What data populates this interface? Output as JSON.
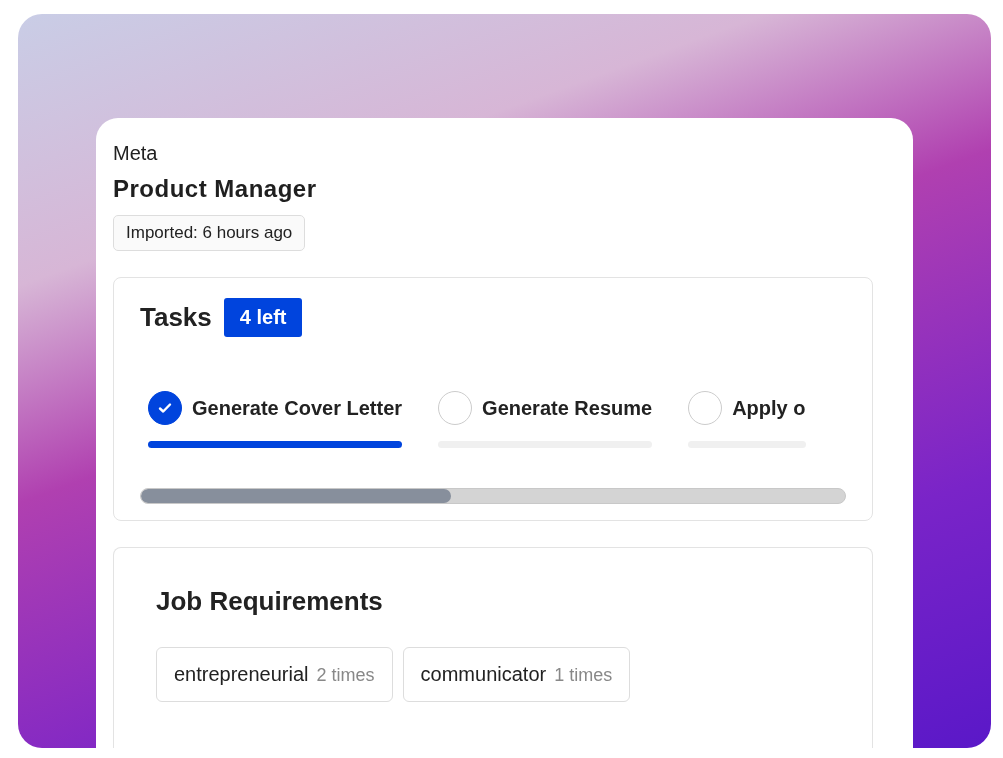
{
  "company": "Meta",
  "job_title": "Product Manager",
  "imported": "Imported: 6 hours ago",
  "tasks": {
    "title": "Tasks",
    "badge": "4 left",
    "items": [
      {
        "label": "Generate Cover Letter",
        "selected": true
      },
      {
        "label": "Generate Resume",
        "selected": false
      },
      {
        "label": "Apply o",
        "selected": false
      }
    ],
    "progress": {
      "level": 0.44
    }
  },
  "requirements": {
    "title": "Job Requirements",
    "items": [
      {
        "label": "entrepreneurial",
        "count": "2 times"
      },
      {
        "label": "communicator",
        "count": "1 times"
      }
    ]
  }
}
